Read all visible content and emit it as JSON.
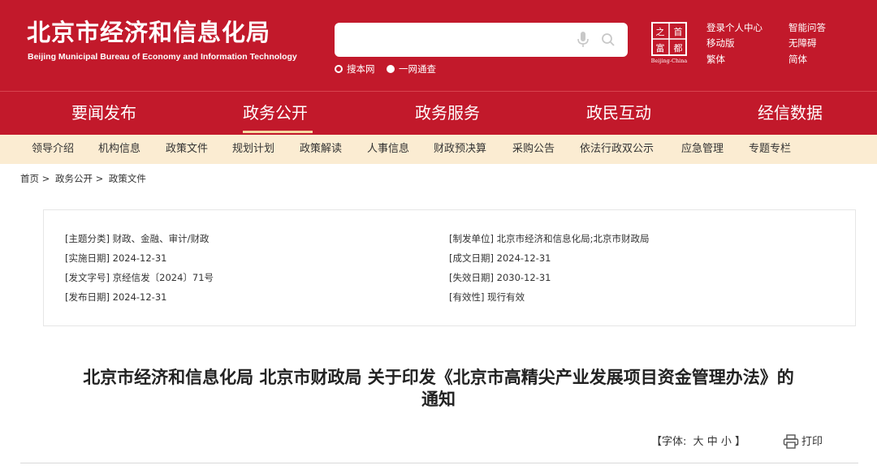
{
  "header": {
    "logo_cn": "北京市经济和信息化局",
    "logo_en": "Beijing Municipal Bureau of Economy and Information Technology",
    "search": {
      "placeholder": "",
      "value": ""
    },
    "scope_site": "搜本网",
    "scope_all": "一网通查",
    "emblem_chars": [
      "之",
      "首",
      "都",
      "富"
    ],
    "emblem_caption": "Beijing-China",
    "links": [
      "登录个人中心",
      "智能问答",
      "移动版",
      "无障碍",
      "繁体",
      "简体"
    ]
  },
  "mainnav": [
    "要闻发布",
    "政务公开",
    "政务服务",
    "政民互动",
    "经信数据"
  ],
  "subnav": [
    "领导介绍",
    "机构信息",
    "政策文件",
    "规划计划",
    "政策解读",
    "人事信息",
    "财政预决算",
    "采购公告",
    "依法行政双公示",
    "应急管理",
    "专题专栏"
  ],
  "breadcrumb": [
    "首页",
    ">",
    "政务公开",
    ">",
    "政策文件"
  ],
  "meta": {
    "topic": "[主题分类] 财政、金融、审计/财政",
    "implement_date": "[实施日期] 2024-12-31",
    "doc_number": "[发文字号] 京经信发〔2024〕71号",
    "publish_date": "[发布日期] 2024-12-31",
    "issuer": "[制发单位] 北京市经济和信息化局;北京市财政局",
    "created_date": "[成文日期] 2024-12-31",
    "expire_date": "[失效日期] 2030-12-31",
    "validity": "[有效性] 现行有效"
  },
  "doc": {
    "title_line1": "北京市经济和信息化局 北京市财政局 关于印发《北京市高精尖产业发展项目资金管理办法》的",
    "title_line2": "通知"
  },
  "tools": {
    "font_prefix": "【字体:",
    "font_large": "大",
    "font_medium": "中",
    "font_small": "小",
    "font_suffix": "】",
    "print": "打印"
  },
  "colors": {
    "brand_red": "#c2192b",
    "subnav_bg": "#fbecd2",
    "underline": "#f5d9a0"
  }
}
